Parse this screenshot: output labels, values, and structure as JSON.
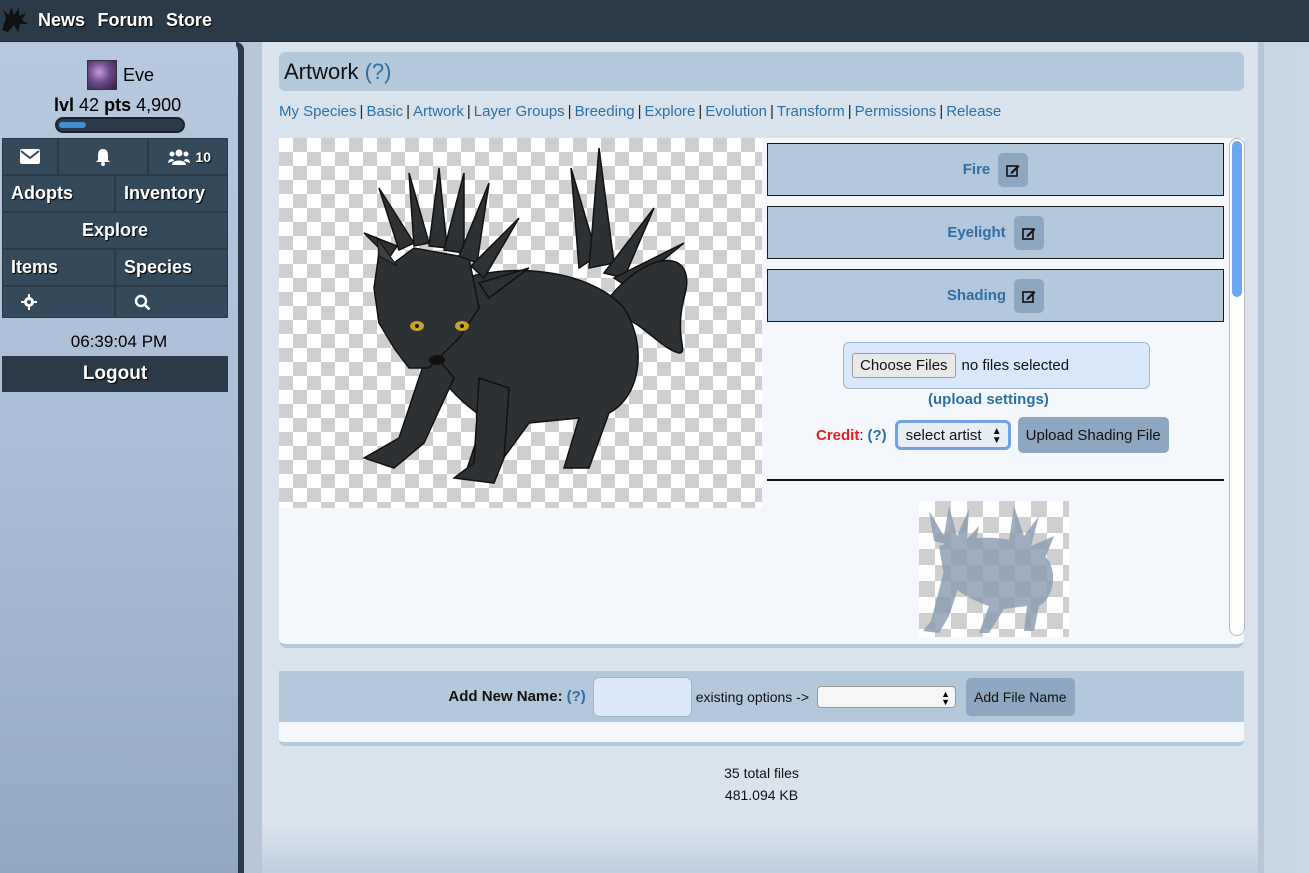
{
  "topnav": {
    "items": [
      "News",
      "Forum",
      "Store"
    ]
  },
  "user": {
    "name": "Eve",
    "level_label": "lvl",
    "level": "42",
    "points_label": "pts",
    "points": "4,900",
    "xp_progress": 0.22
  },
  "sidebar": {
    "friends_count": "10",
    "adopts": "Adopts",
    "inventory": "Inventory",
    "explore": "Explore",
    "items": "Items",
    "species": "Species",
    "time": "06:39:04 PM",
    "logout": "Logout"
  },
  "page": {
    "title": "Artwork",
    "help": "(?)"
  },
  "subnav": [
    "My Species",
    "Basic",
    "Artwork",
    "Layer Groups",
    "Breeding",
    "Explore",
    "Evolution",
    "Transform",
    "Permissions",
    "Release"
  ],
  "layers": [
    "Fire",
    "Eyelight",
    "Shading"
  ],
  "upload": {
    "choose_label": "Choose Files",
    "no_files": "no files selected",
    "settings_link": "(upload settings)",
    "credit_label": "Credit",
    "credit_sep": ":",
    "credit_help": "(?)",
    "artist_select": "select artist",
    "upload_button": "Upload Shading File"
  },
  "add_name": {
    "label": "Add New Name",
    "sep": ":",
    "help": "(?)",
    "existing": "existing options ->",
    "button": "Add File Name",
    "selected_option": ""
  },
  "totals": {
    "files": "35 total files",
    "size": "481.094 KB"
  },
  "colors": {
    "topbar": "#2b3a48",
    "link": "#2d6fa3",
    "credit": "#e41f1f",
    "panel": "#b4c8dc"
  }
}
